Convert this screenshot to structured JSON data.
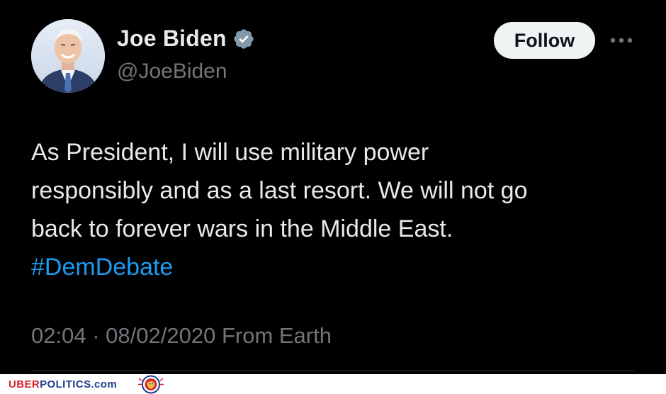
{
  "author": {
    "display_name": "Joe Biden",
    "handle": "@JoeBiden",
    "verified": true,
    "avatar_icon": "avatar-photo"
  },
  "actions": {
    "follow_label": "Follow",
    "more_icon": "more-horizontal-icon"
  },
  "tweet": {
    "lines": [
      "As President, I will use military power",
      "responsibly and as a last resort. We will not go",
      "back to forever wars in the Middle East."
    ],
    "hashtag": "#DemDebate"
  },
  "meta": {
    "time": "02:04",
    "separator": "·",
    "date": "08/02/2020",
    "source": "From Earth"
  },
  "watermark": {
    "text_part1": "UBER",
    "text_part2": "POLITICS",
    "text_part3": ".com"
  },
  "colors": {
    "background": "#000000",
    "text_primary": "#e7e9ea",
    "text_secondary": "#71767b",
    "link": "#1d9bf0",
    "follow_button_bg": "#eff3f4",
    "watermark_red": "#d7262c",
    "watermark_blue": "#1f3f8c"
  }
}
